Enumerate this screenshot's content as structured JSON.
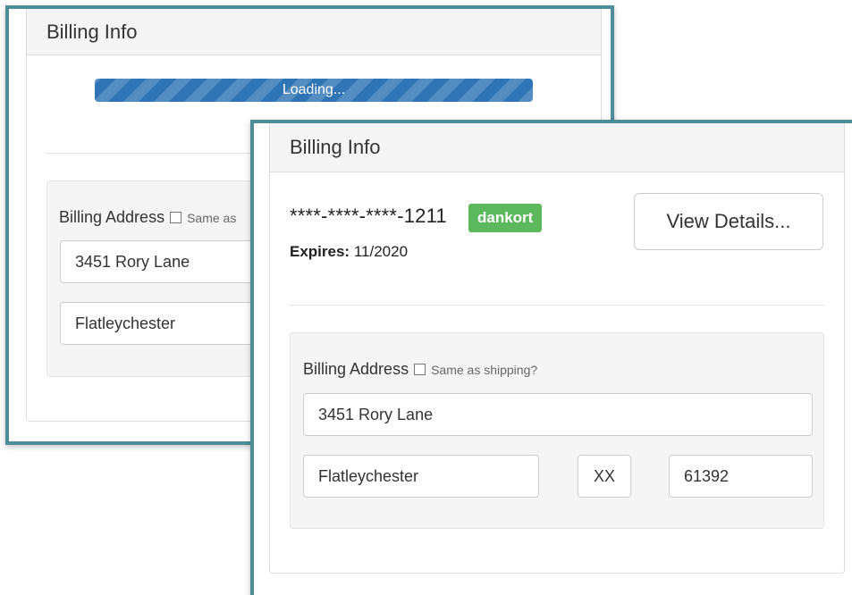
{
  "back_window": {
    "panel_title": "Billing Info",
    "progress": {
      "label": "Loading...",
      "percent": 100
    },
    "billing_address": {
      "label": "Billing Address",
      "same_as_label": "Same as",
      "street": "3451 Rory Lane",
      "city": "Flatleychester"
    }
  },
  "front_window": {
    "panel_title": "Billing Info",
    "card": {
      "number": "****-****-****-1211",
      "brand_badge": "dankort",
      "expires_label": "Expires:",
      "expires_value": "11/2020"
    },
    "view_details_button": "View Details...",
    "billing_address": {
      "label": "Billing Address",
      "same_as_label": "Same as shipping?",
      "same_as_checked": false,
      "street": "3451 Rory Lane",
      "city": "Flatleychester",
      "state": "XX",
      "zip": "61392"
    }
  },
  "colors": {
    "frame_border": "#4e8c98",
    "progress_bar": "#2f74b5",
    "badge": "#5cb85c"
  }
}
